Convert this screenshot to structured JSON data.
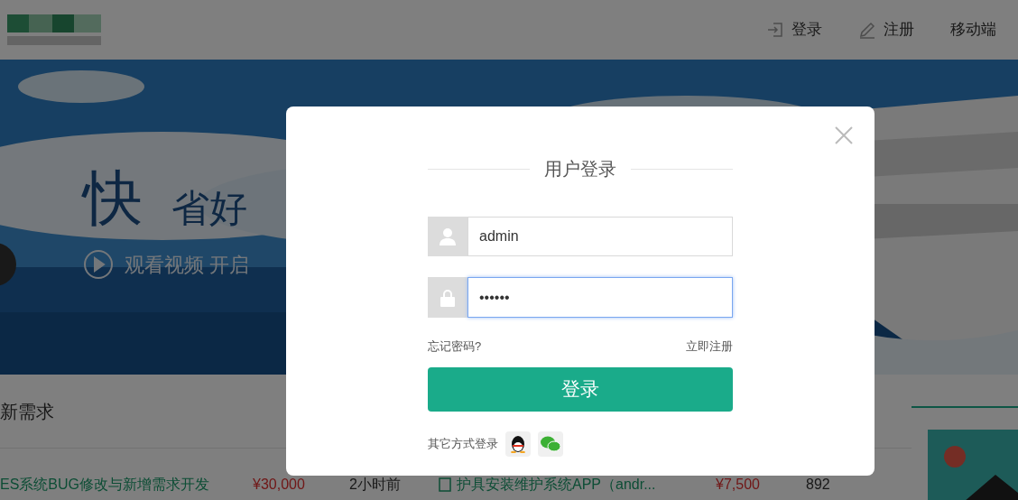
{
  "header": {
    "nav": [
      {
        "label": "登录",
        "kind": "login"
      },
      {
        "label": "注册",
        "kind": "register"
      },
      {
        "label": "移动端",
        "kind": "plain"
      }
    ]
  },
  "hero": {
    "headline": "快",
    "subheadline": "省好",
    "video_link": "观看视频 开启"
  },
  "demands": {
    "title": "新需求",
    "rows": [
      {
        "title": "ES系统BUG修改与新增需求开发",
        "price": "¥30,000",
        "time": "2小时前"
      },
      {
        "title": "护具安装维护系统APP（andr...",
        "price": "¥7,500",
        "time": "892"
      }
    ]
  },
  "login_dialog": {
    "title": "用户登录",
    "username": {
      "value": "admin",
      "focused": false
    },
    "password": {
      "value": "••••••",
      "focused": true
    },
    "forgot_link": "忘记密码?",
    "register_link": "立即注册",
    "submit": "登录",
    "other_methods_label": "其它方式登录"
  }
}
